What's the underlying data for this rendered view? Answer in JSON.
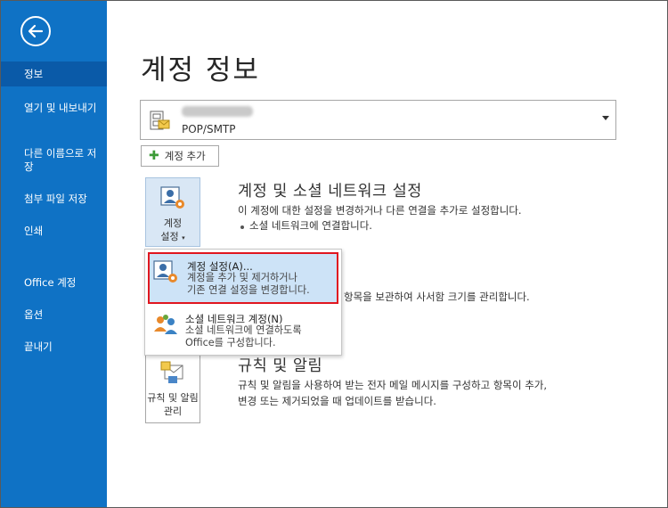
{
  "sidebar": {
    "items": [
      {
        "label": "정보"
      },
      {
        "label": "열기 및 내보내기"
      },
      {
        "label": "다른 이름으로 저장"
      },
      {
        "label": "첨부 파일 저장"
      },
      {
        "label": "인쇄"
      },
      {
        "label": "Office 계정"
      },
      {
        "label": "옵션"
      },
      {
        "label": "끝내기"
      }
    ]
  },
  "main": {
    "title": "계정 정보",
    "account": {
      "type": "POP/SMTP"
    },
    "add_account_label": "계정 추가",
    "settings_tile": {
      "line1": "계정",
      "line2": "설정"
    },
    "settings_section": {
      "title": "계정 및 소셜 네트워크 설정",
      "desc": "이 계정에 대한 설정을 변경하거나 다른 연결을 추가로 설정합니다.",
      "bullet": "소셜 네트워크에 연결합니다."
    },
    "mailbox_partial": "항목을 보관하여 사서함 크기를 관리합니다.",
    "rules_tile": {
      "line1": "규칙 및 알림",
      "line2": "관리"
    },
    "rules_section": {
      "title": "규칙 및 알림",
      "line1": "규칙 및 알림을 사용하여 받는 전자 메일 메시지를 구성하고 항목이 추가,",
      "line2": "변경 또는 제거되었을 때 업데이트를 받습니다."
    }
  },
  "menu": {
    "items": [
      {
        "title": "계정 설정(A)...",
        "desc1": "계정을 추가 및 제거하거나",
        "desc2": "기존 연결 설정을 변경합니다."
      },
      {
        "title": "소셜 네트워크 계정(N)",
        "desc1": "소셜 네트워크에 연결하도록",
        "desc2": "Office를 구성합니다."
      }
    ]
  }
}
